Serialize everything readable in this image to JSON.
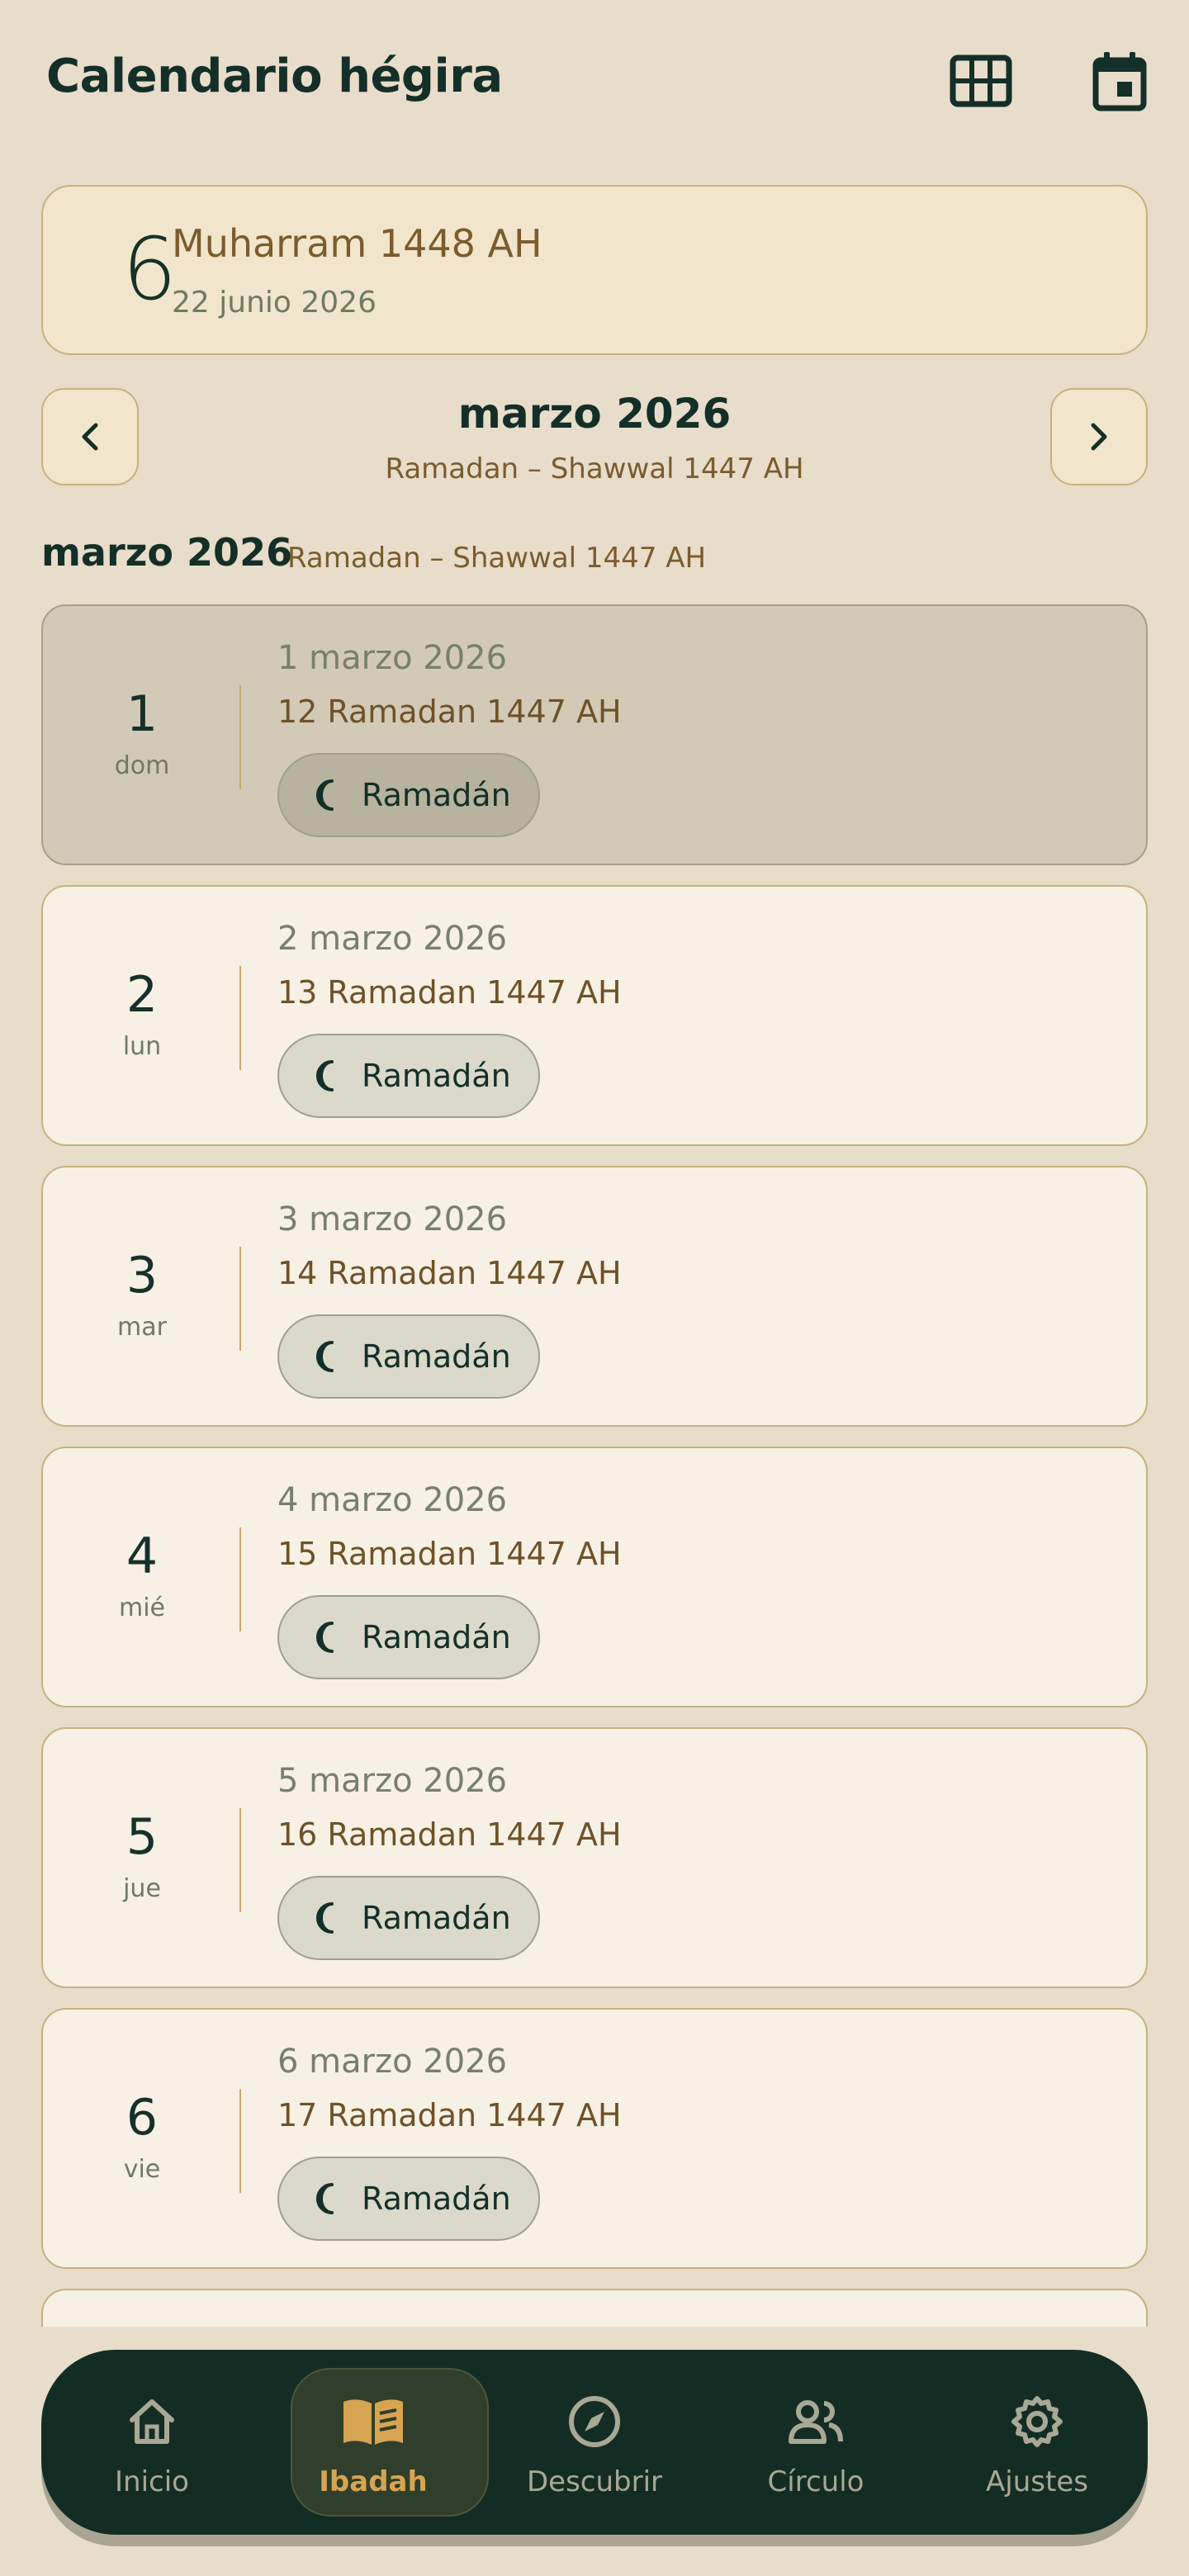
{
  "header": {
    "title": "Calendario hégira",
    "grid_icon": "grid-icon",
    "calendar_icon": "calendar-icon"
  },
  "today": {
    "day": "6",
    "hijri": "Muharram 1448 AH",
    "gregorian": "22 junio 2026"
  },
  "month_nav": {
    "title": "marzo 2026",
    "subtitle": "Ramadan – Shawwal 1447 AH",
    "prev_icon": "chevron-left-icon",
    "next_icon": "chevron-right-icon"
  },
  "section": {
    "title": "marzo 2026",
    "subtitle": "Ramadan – Shawwal 1447 AH"
  },
  "days": [
    {
      "num": "1",
      "weekday": "dom",
      "gregorian": "1 marzo 2026",
      "hijri": "12 Ramadan 1447 AH",
      "chip": "Ramadán",
      "selected": true
    },
    {
      "num": "2",
      "weekday": "lun",
      "gregorian": "2 marzo 2026",
      "hijri": "13 Ramadan 1447 AH",
      "chip": "Ramadán",
      "selected": false
    },
    {
      "num": "3",
      "weekday": "mar",
      "gregorian": "3 marzo 2026",
      "hijri": "14 Ramadan 1447 AH",
      "chip": "Ramadán",
      "selected": false
    },
    {
      "num": "4",
      "weekday": "mié",
      "gregorian": "4 marzo 2026",
      "hijri": "15 Ramadan 1447 AH",
      "chip": "Ramadán",
      "selected": false
    },
    {
      "num": "5",
      "weekday": "jue",
      "gregorian": "5 marzo 2026",
      "hijri": "16 Ramadan 1447 AH",
      "chip": "Ramadán",
      "selected": false
    },
    {
      "num": "6",
      "weekday": "vie",
      "gregorian": "6 marzo 2026",
      "hijri": "17 Ramadan 1447 AH",
      "chip": "Ramadán",
      "selected": false
    },
    {
      "num": "",
      "weekday": "",
      "gregorian": "",
      "hijri": "",
      "chip": "",
      "selected": false
    }
  ],
  "bottom_nav": [
    {
      "label": "Inicio",
      "icon": "home-icon",
      "active": false
    },
    {
      "label": "Ibadah",
      "icon": "book-icon",
      "active": true
    },
    {
      "label": "Descubrir",
      "icon": "compass-icon",
      "active": false
    },
    {
      "label": "Círculo",
      "icon": "people-icon",
      "active": false
    },
    {
      "label": "Ajustes",
      "icon": "gear-icon",
      "active": false
    }
  ],
  "colors": {
    "background": "#E8DDCA",
    "primary": "#142D24",
    "accent": "#D7A452",
    "card": "#F7F0E4",
    "selected_card": "#D2CAB7"
  }
}
